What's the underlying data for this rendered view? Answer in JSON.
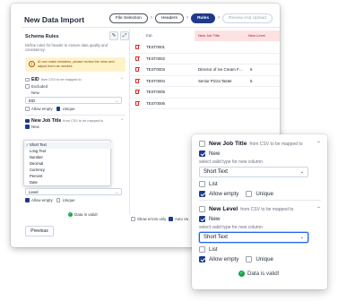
{
  "window": {
    "title": "New Data Import"
  },
  "stepper": {
    "steps": [
      "File Selection",
      "Headers",
      "Rules",
      "Review And Upload"
    ]
  },
  "schema": {
    "title": "Schema Rules",
    "description": "Define rules for header to ensure data quality and consistency.",
    "warning": "AI can make mistakes, please review the rules and adjust them as needed.",
    "fields": [
      {
        "name": "EID",
        "hint": "from CSV to be mapped to",
        "excluded_label": "Excluded",
        "new_label": "New",
        "type_value": "EID",
        "allow_empty_label": "Allow empty",
        "unique_label": "Unique"
      },
      {
        "name": "New Job Title",
        "hint": "from CSV to be mapped to",
        "new_label": "New",
        "type_value": "Short Text",
        "allow_empty_label": "Allow empty",
        "unique_label": "Unique"
      },
      {
        "name": "New Level",
        "hint": "from CSV to be mapped to",
        "new_label": "New",
        "type_value": "Level",
        "allow_empty_label": "Allow empty",
        "unique_label": "Unique"
      }
    ],
    "type_options": [
      "Short Text",
      "Long Text",
      "Number",
      "Decimal",
      "Currency",
      "Percent",
      "Date"
    ],
    "valid_text": "Data is valid!",
    "previous_label": "Previous"
  },
  "table": {
    "columns": [
      "EID",
      "New Job Title",
      "New Level"
    ],
    "rows": [
      [
        "TEST0001",
        "",
        ""
      ],
      [
        "TEST0002",
        "",
        ""
      ],
      [
        "TEST0003",
        "Director of Ice Cream F…",
        "6"
      ],
      [
        "TEST0004",
        "Senior Pizza Taster",
        "5"
      ],
      [
        "TEST0005",
        "",
        ""
      ],
      [
        "TEST0006",
        "",
        ""
      ]
    ],
    "show_errors_label": "Show errors only",
    "auto_label": "Auto Va"
  },
  "zoom": {
    "job_title": {
      "name": "New Job Title",
      "hint": "from CSV to be mapped to",
      "new_label": "New",
      "select_hint": "select valid type for new column",
      "type_value": "Short Text",
      "list_label": "List",
      "allow_empty_label": "Allow empty",
      "unique_label": "Unique"
    },
    "level": {
      "name": "New Level",
      "hint": "from CSV to be mapped to",
      "new_label": "New",
      "select_hint": "select valid type for new column",
      "type_value": "Short Text",
      "list_label": "List",
      "allow_empty_label": "Allow empty",
      "unique_label": "Unique"
    },
    "valid_text": "Data is valid!"
  },
  "colors": {
    "accent": "#1e3a8a",
    "error_header": "#fde2e2",
    "success": "#16a34a",
    "warning_bg": "#fef3c7"
  }
}
